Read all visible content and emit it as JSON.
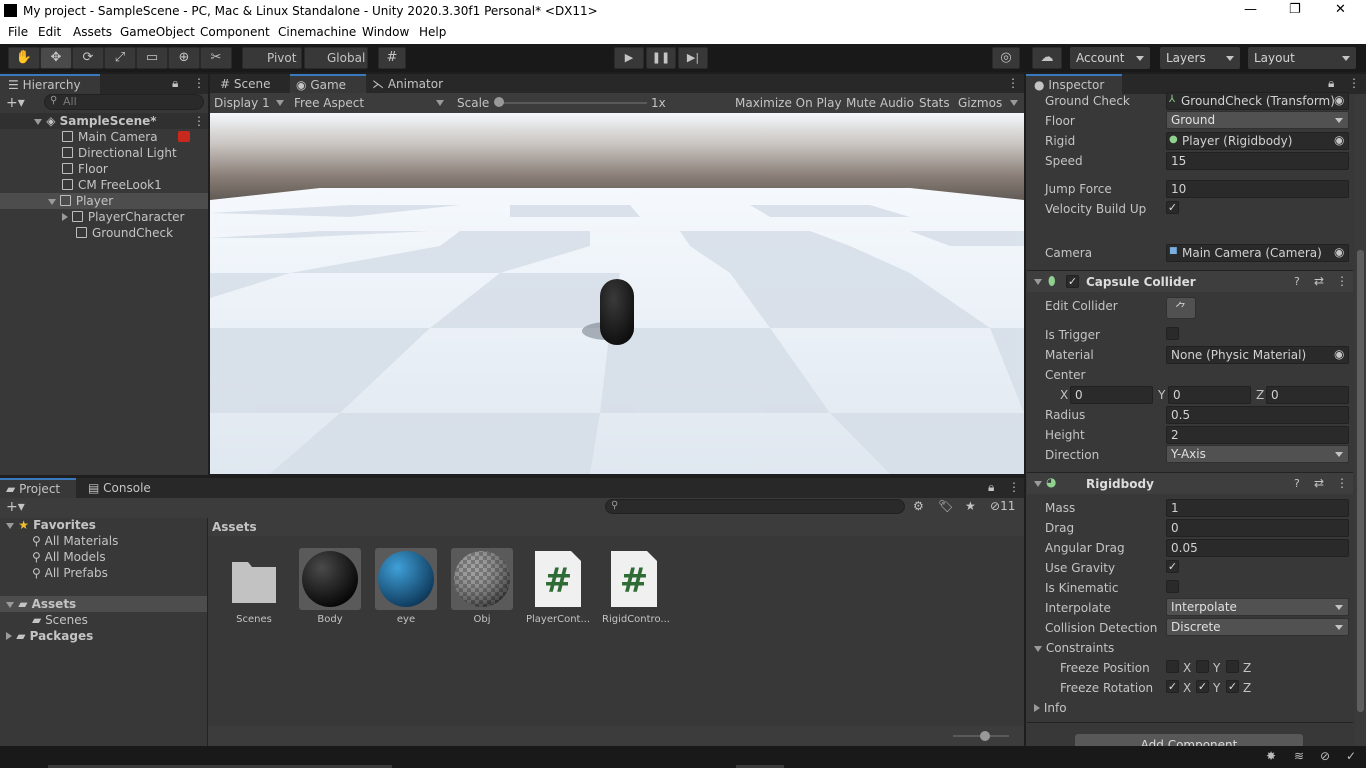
{
  "window": {
    "title": "My project - SampleScene - PC, Mac & Linux Standalone - Unity 2020.3.30f1 Personal* <DX11>"
  },
  "menu": [
    "File",
    "Edit",
    "Assets",
    "GameObject",
    "Component",
    "Cinemachine",
    "Window",
    "Help"
  ],
  "toolbar": {
    "pivot": "Pivot",
    "global": "Global",
    "account": "Account",
    "layers": "Layers",
    "layout": "Layout"
  },
  "hierarchy": {
    "tab": "Hierarchy",
    "search_placeholder": "All",
    "scene": "SampleScene*",
    "items": [
      "Main Camera",
      "Directional Light",
      "Floor",
      "CM FreeLook1",
      "Player",
      "PlayerCharacter",
      "GroundCheck"
    ]
  },
  "center_tabs": [
    "Scene",
    "Game",
    "Animator"
  ],
  "game": {
    "display": "Display 1",
    "aspect": "Free Aspect",
    "scale_label": "Scale",
    "scale_value": "1x",
    "maximize": "Maximize On Play",
    "mute": "Mute Audio",
    "stats": "Stats",
    "gizmos": "Gizmos"
  },
  "project": {
    "tab": "Project",
    "console_tab": "Console",
    "favorites": "Favorites",
    "fav_items": [
      "All Materials",
      "All Models",
      "All Prefabs"
    ],
    "assets": "Assets",
    "scenes": "Scenes",
    "packages": "Packages",
    "breadcrumb": "Assets",
    "hidden_count": "11",
    "items": [
      "Scenes",
      "Body",
      "eye",
      "Obj",
      "PlayerCont...",
      "RigidContro..."
    ]
  },
  "inspector": {
    "tab": "Inspector",
    "script_fields": [
      {
        "label": "Ground Check",
        "value": "GroundCheck (Transform)"
      },
      {
        "label": "Floor",
        "value": "Ground"
      },
      {
        "label": "Rigid",
        "value": "Player (Rigidbody)"
      },
      {
        "label": "Speed",
        "value": "15"
      },
      {
        "label": "Jump Force",
        "value": "10"
      },
      {
        "label": "Velocity Build Up",
        "value": "✓"
      },
      {
        "label": "Camera",
        "value": "Main Camera (Camera)"
      }
    ],
    "capsule": {
      "title": "Capsule Collider",
      "edit_collider": "Edit Collider",
      "is_trigger": "Is Trigger",
      "material": "Material",
      "material_value": "None (Physic Material)",
      "center": "Center",
      "cx_label": "X",
      "cx": "0",
      "cy_label": "Y",
      "cy": "0",
      "cz_label": "Z",
      "cz": "0",
      "radius": "Radius",
      "radius_value": "0.5",
      "height": "Height",
      "height_value": "2",
      "direction": "Direction",
      "direction_value": "Y-Axis"
    },
    "rigidbody": {
      "title": "Rigidbody",
      "mass": "Mass",
      "mass_value": "1",
      "drag": "Drag",
      "drag_value": "0",
      "angular_drag": "Angular Drag",
      "angular_drag_value": "0.05",
      "use_gravity": "Use Gravity",
      "is_kinematic": "Is Kinematic",
      "interpolate": "Interpolate",
      "interpolate_value": "Interpolate",
      "collision": "Collision Detection",
      "collision_value": "Discrete",
      "constraints": "Constraints",
      "freeze_pos": "Freeze Position",
      "freeze_rot": "Freeze Rotation",
      "x": "X",
      "y": "Y",
      "z": "Z",
      "info": "Info"
    },
    "add_component": "Add Component"
  }
}
